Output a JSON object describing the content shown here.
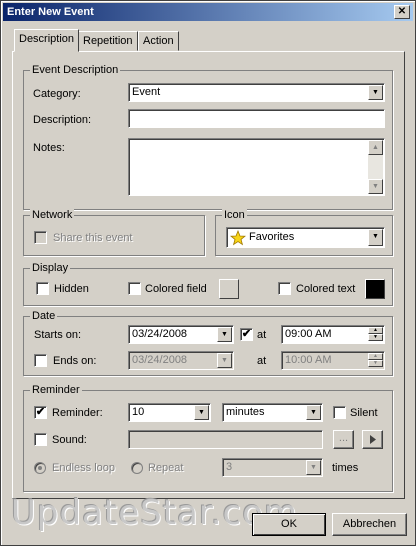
{
  "window": {
    "title": "Enter New Event",
    "close_glyph": "✕"
  },
  "tabs": [
    {
      "label": "Description"
    },
    {
      "label": "Repetition"
    },
    {
      "label": "Action"
    }
  ],
  "event_description": {
    "legend": "Event Description",
    "category_label": "Category:",
    "category_value": "Event",
    "description_label": "Description:",
    "description_value": "",
    "notes_label": "Notes:",
    "notes_value": ""
  },
  "network": {
    "legend": "Network",
    "share_label": "Share this event",
    "share_checked": false
  },
  "icon": {
    "legend": "Icon",
    "value": "Favorites",
    "icon_name": "star-icon"
  },
  "display": {
    "legend": "Display",
    "hidden_label": "Hidden",
    "colored_field_label": "Colored field",
    "colored_text_label": "Colored text",
    "colored_field_color": "#d4d0c8",
    "colored_text_color": "#000000"
  },
  "date": {
    "legend": "Date",
    "starts_label": "Starts on:",
    "starts_date": "03/24/2008",
    "at_label": "at",
    "starts_time": "09:00 AM",
    "ends_label": "Ends on:",
    "ends_date": "03/24/2008",
    "ends_time": "10:00 AM"
  },
  "reminder": {
    "legend": "Reminder",
    "reminder_label": "Reminder:",
    "reminder_value": "10",
    "unit_value": "minutes",
    "silent_label": "Silent",
    "sound_label": "Sound:",
    "browse_label": "...",
    "endless_label": "Endless loop",
    "repeat_label": "Repeat",
    "repeat_value": "3",
    "times_label": "times"
  },
  "buttons": {
    "ok": "OK",
    "cancel": "Abbrechen"
  },
  "watermark": "UpdateStar.com"
}
